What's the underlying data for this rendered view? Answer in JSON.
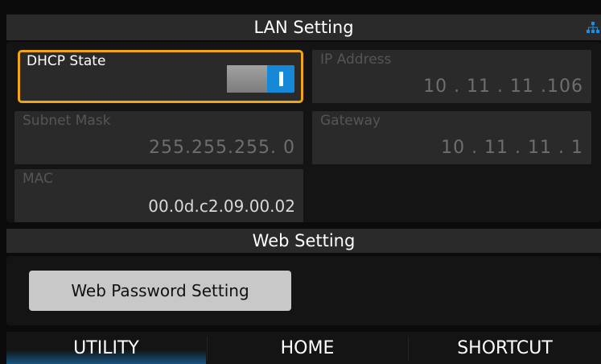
{
  "lan_section": {
    "title": "LAN Setting",
    "network_icon": "network-icon"
  },
  "dhcp": {
    "label": "DHCP State",
    "enabled": true
  },
  "ip_address": {
    "label": "IP Address",
    "value": "10 . 11 . 11 .106"
  },
  "subnet_mask": {
    "label": "Subnet Mask",
    "value": "255.255.255. 0"
  },
  "gateway": {
    "label": "Gateway",
    "value": "10 . 11 . 11 . 1"
  },
  "mac": {
    "label": "MAC",
    "value": "00.0d.c2.09.00.02"
  },
  "web_section": {
    "title": "Web Setting",
    "password_button": "Web Password Setting"
  },
  "nav": {
    "utility": "UTILITY",
    "home": "HOME",
    "shortcut": "SHORTCUT",
    "active": "UTILITY"
  },
  "colors": {
    "accent": "#1688d8",
    "focus": "#f0a612"
  }
}
